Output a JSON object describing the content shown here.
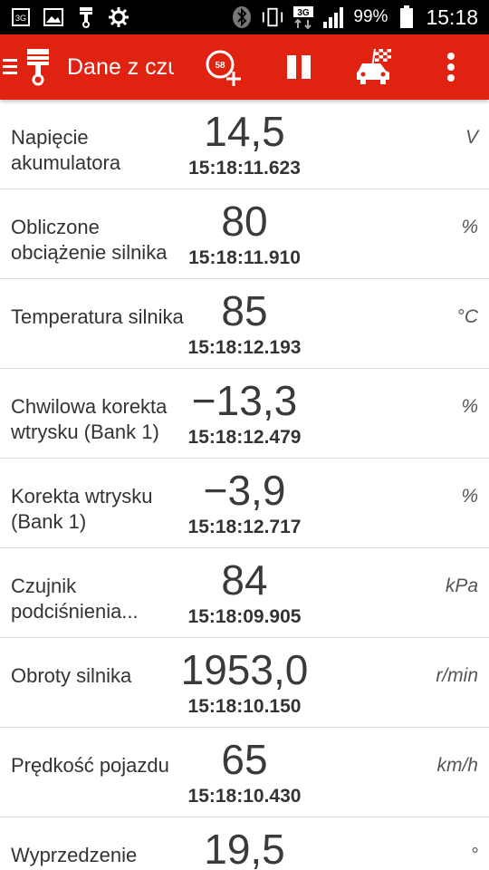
{
  "status_bar": {
    "icons_left": [
      "3g-sim-icon",
      "image-icon",
      "piston-icon",
      "settings-icon"
    ],
    "icons_right": [
      "bluetooth-icon",
      "vibrate-icon",
      "3g-data-icon",
      "signal-icon"
    ],
    "battery": "99%",
    "time": "15:18"
  },
  "app_bar": {
    "title": "Dane z czujników",
    "actions": [
      "speedometer-add-icon",
      "pause-icon",
      "race-car-flag-icon",
      "overflow-menu-icon"
    ],
    "speed_badge": "58"
  },
  "colors": {
    "app_bar": "#e02211",
    "status_bar": "#000000",
    "text": "#3a3a3a"
  },
  "rows": [
    {
      "label": "Napięcie akumulatora",
      "value": "14,5",
      "time": "15:18:11.623",
      "unit": "V"
    },
    {
      "label": "Obliczone obciążenie silnika",
      "value": "80",
      "time": "15:18:11.910",
      "unit": "%"
    },
    {
      "label": "Temperatura silnika",
      "value": "85",
      "time": "15:18:12.193",
      "unit": "°C"
    },
    {
      "label": "Chwilowa korekta wtrysku (Bank 1)",
      "value": "−13,3",
      "time": "15:18:12.479",
      "unit": "%"
    },
    {
      "label": "Korekta wtrysku (Bank 1)",
      "value": "−3,9",
      "time": "15:18:12.717",
      "unit": "%"
    },
    {
      "label": "Czujnik podciśnienia...",
      "value": "84",
      "time": "15:18:09.905",
      "unit": "kPa"
    },
    {
      "label": "Obroty silnika",
      "value": "1953,0",
      "time": "15:18:10.150",
      "unit": "r/min"
    },
    {
      "label": "Prędkość pojazdu",
      "value": "65",
      "time": "15:18:10.430",
      "unit": "km/h"
    },
    {
      "label": "Wyprzedzenie",
      "value": "19,5",
      "time": "",
      "unit": "°"
    }
  ]
}
